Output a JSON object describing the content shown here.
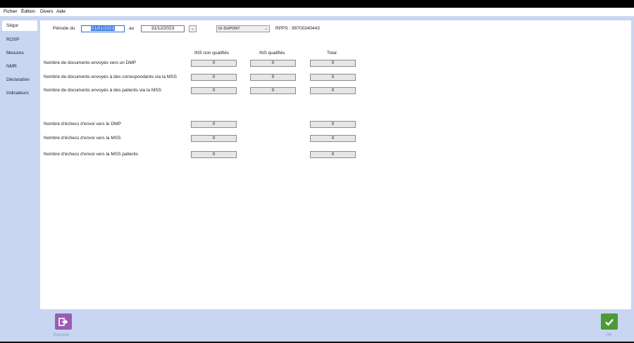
{
  "menu": {
    "items": [
      "Fichier",
      "Édition",
      "Divers",
      "Aide"
    ]
  },
  "sidebar": {
    "items": [
      {
        "label": "Ségur"
      },
      {
        "label": "ROSP"
      },
      {
        "label": "Mesures"
      },
      {
        "label": "NMR"
      },
      {
        "label": "Déclaration"
      },
      {
        "label": "Indicateurs"
      }
    ]
  },
  "filters": {
    "period_label": "Période du",
    "date_from": "01/01/2023",
    "between_label": "au",
    "date_to": "31/12/2023",
    "doctor": "Dr DUPONT",
    "rpps": "RPPS : 99700340443"
  },
  "table": {
    "headers": [
      "INS non qualifiés",
      "INS qualifiés",
      "Total"
    ],
    "rows": [
      {
        "label": "Nombre de documents envoyés vers un DMP",
        "values": [
          "0",
          "0",
          "0"
        ]
      },
      {
        "label": "Nombre de documents envoyés à des correspondants via la MSS",
        "values": [
          "0",
          "0",
          "0"
        ]
      },
      {
        "label": "Nombre de documents envoyés à des patients via la MSS",
        "values": [
          "0",
          "0",
          "0"
        ]
      }
    ],
    "failures": [
      {
        "label": "Nombre d'échecs d'envoi vers le DMP",
        "values": [
          "0",
          "0"
        ]
      },
      {
        "label": "Nombre d'échecs d'envoi vers la MSS",
        "values": [
          "0",
          "0"
        ]
      },
      {
        "label": "Nombre d'échecs d'envoi vers la MSS patients",
        "values": [
          "0",
          "0"
        ]
      }
    ]
  },
  "footer": {
    "export_label": "Exporter",
    "ok_label": "OK"
  },
  "colors": {
    "export": "#9b5cb4",
    "ok": "#4f9a37",
    "background": "#c8d6f2"
  }
}
